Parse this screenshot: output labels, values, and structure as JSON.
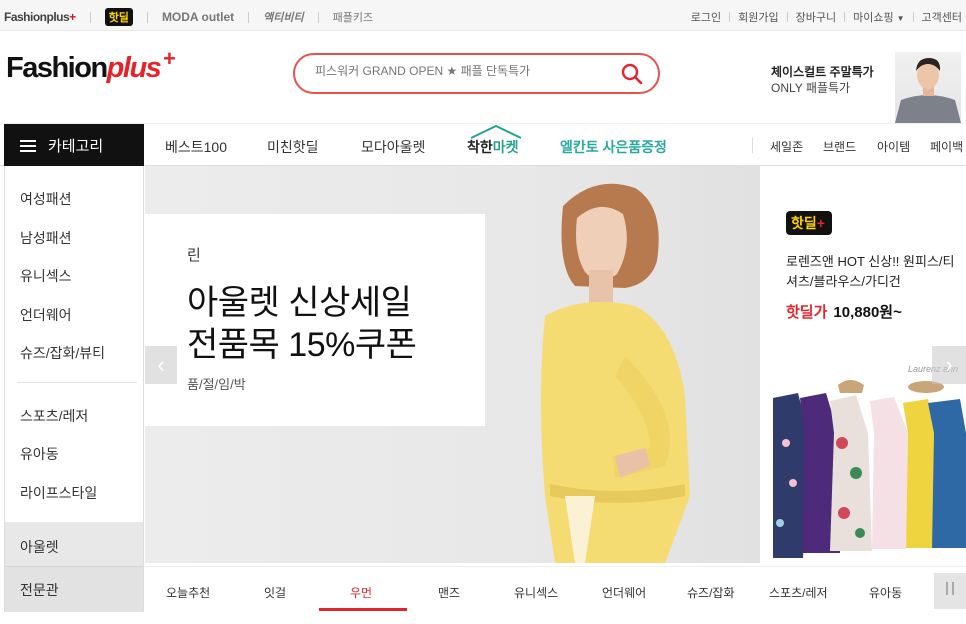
{
  "topbar": {
    "sites": {
      "fashionplus": "Fashionplus",
      "hotdeal": "핫딜",
      "moda": "MODA outlet",
      "act": "액티비티",
      "kids": "패플키즈"
    },
    "util": {
      "login": "로그인",
      "signup": "회원가입",
      "cart": "장바구니",
      "myshopping": "마이쇼핑",
      "support": "고객센터"
    }
  },
  "header": {
    "logo_main": "Fashion",
    "logo_plus": "plus",
    "search_placeholder": "피스워커 GRAND OPEN ★ 패플 단독특가",
    "promo_title": "체이스컬트 주말특가",
    "promo_sub": "ONLY 패플특가"
  },
  "nav": {
    "category_label": "카테고리",
    "items": [
      "베스트100",
      "미친핫딜",
      "모다아울렛",
      "엘칸토 사은품증정"
    ],
    "good_market_prefix": "착한",
    "good_market_suffix": "마켓",
    "right": [
      "세일존",
      "브랜드",
      "아이템",
      "페이백"
    ]
  },
  "sidebar": {
    "group1": [
      "여성패션",
      "남성패션",
      "유니섹스",
      "언더웨어",
      "슈즈/잡화/뷰티"
    ],
    "group2": [
      "스포츠/레저",
      "유아동",
      "라이프스타일"
    ],
    "outlet": "아울렛",
    "specialty": "전문관"
  },
  "hero": {
    "brand": "린",
    "title_line1": "아울렛 신상세일",
    "title_line2": "전품목 15%쿠폰",
    "subtitle": "품/절/임/박"
  },
  "side_promo": {
    "badge": "핫딜",
    "description": "로렌즈앤 HOT 신상!! 원피스/티셔츠/블라우스/가디건",
    "price_label": "핫딜가",
    "price": "10,880원~",
    "brand_mark": "Laurenz ann"
  },
  "tabs": {
    "items": [
      "오늘추천",
      "잇걸",
      "우먼",
      "맨즈",
      "유니섹스",
      "언더웨어",
      "슈즈/잡화",
      "스포츠/레저",
      "유아동"
    ],
    "active_index": 2
  },
  "colors": {
    "accent": "#e3242b",
    "mint": "#29a8a0",
    "dark": "#111111"
  }
}
